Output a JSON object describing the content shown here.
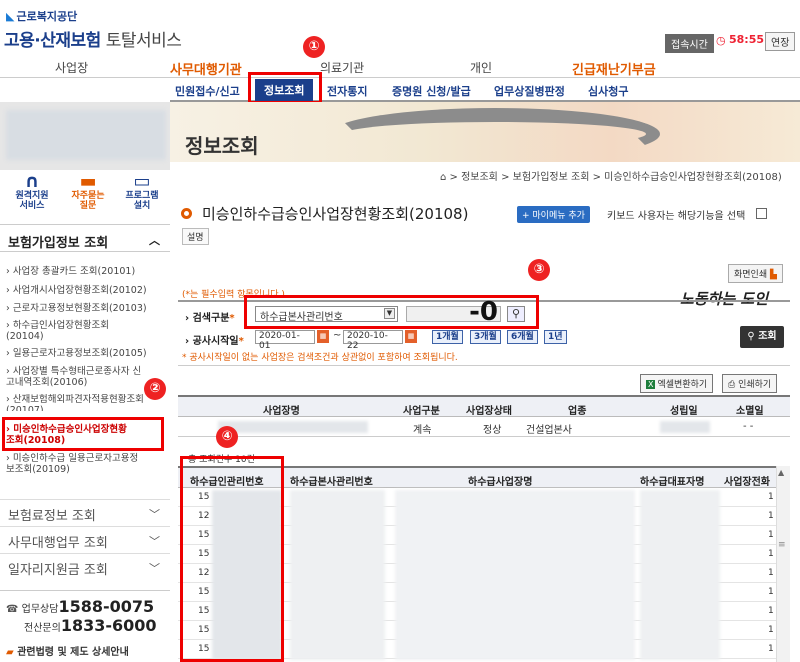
{
  "header": {
    "org_name": "근로복지공단",
    "service_title": "고용·산재보험",
    "service_sub": " 토탈서비스",
    "session_label": "접속시간",
    "session_time": "58:55",
    "extend_label": "연장"
  },
  "top_nav": [
    "사업장",
    "사무대행기관",
    "의료기관",
    "개인",
    "긴급재난기부금"
  ],
  "sub_nav": [
    "민원접수/신고",
    "정보조회",
    "전자통지",
    "증명원 신청/발급",
    "업무상질병판정",
    "심사청구"
  ],
  "badges": [
    "①",
    "②",
    "③",
    "④"
  ],
  "quick_links": [
    {
      "icon": "headset-icon",
      "glyph": "🎧",
      "label": "원격지원\n서비스"
    },
    {
      "icon": "chat-icon",
      "glyph": "💬",
      "label": "자주묻는\n질문"
    },
    {
      "icon": "monitor-icon",
      "glyph": "🖥",
      "label": "프로그램\n설치"
    }
  ],
  "sidebar": {
    "section_title": "보험가입정보 조회",
    "items": [
      "› 사업장 총괄카드 조회(20101)",
      "› 사업개시사업장현황조회(20102)",
      "› 근로자고용정보현황조회(20103)",
      "› 하수급인사업장현황조회\n  (20104)",
      "› 일용근로자고용정보조회(20105)",
      "› 사업장별 특수형태근로종사자 신\n  고내역조회(20106)",
      "› 산재보험해외파견자적용현황조회\n  (20107)",
      "› 미승인하수급승인사업장현황\n  조회(20108)",
      "› 미승인하수급 일용근로자고용정\n  보조회(20109)"
    ],
    "groups": [
      "보험료정보 조회",
      "사무대행업무 조회",
      "일자리지원금 조회"
    ],
    "phone_label1": "업무상담",
    "phone_number1": "1588-0075",
    "phone_label2": "전산문의",
    "phone_number2": "1833-6000",
    "law_link": "관련법령 및 제도 상세안내"
  },
  "banner_title": "정보조회",
  "breadcrumb": "⌂ > 정보조회 > 보험가입정보 조회 > 미승인하수급승인사업장현황조회(20108)",
  "page": {
    "title": "미승인하수급승인사업장현황조회(20108)",
    "mymenu_label": "+ 마이메뉴 추가",
    "keyboard_text": "키보드 사용자는 해당기능을 선택",
    "desc_label": "설명"
  },
  "search": {
    "print_screen_label": "화면인쇄",
    "required_note": "(*는 필수입력 항목입니다.)",
    "signature": "노동하는 도인",
    "type_label": "검색구분",
    "type_value": "하수급본사관리번호",
    "input_value": "-0",
    "period_label": "공사시작일",
    "date_from": "2020-01-01",
    "date_to": "2020-10-22",
    "period_buttons": [
      "1개월",
      "3개월",
      "6개월",
      "1년"
    ],
    "note": "* 공사시작일이 없는 사업장은 검색조건과 상관없이 포함하여 조회됩니다.",
    "search_button": "조회"
  },
  "actions": {
    "excel_label": "엑셀변환하기",
    "print_label": "인쇄하기"
  },
  "table1": {
    "headers": [
      "사업장명",
      "사업구분",
      "사업장상태",
      "업종",
      "성립일",
      "소멸일"
    ],
    "row": [
      "",
      "계속",
      "정상",
      "건설업본사",
      "",
      "- -"
    ]
  },
  "table2": {
    "total": "총 조회건수 10건",
    "headers": [
      "하수급인관리번호",
      "하수급본사관리번호",
      "하수급사업장명",
      "하수급대표자명",
      "사업장전화"
    ],
    "rows": [
      [
        "15",
        "1"
      ],
      [
        "12",
        "1"
      ],
      [
        "15",
        "1"
      ],
      [
        "15",
        "1"
      ],
      [
        "12",
        "1"
      ],
      [
        "15",
        "1"
      ],
      [
        "15",
        "1"
      ],
      [
        "15",
        "1"
      ],
      [
        "15",
        "1"
      ],
      [
        "15",
        "1"
      ]
    ]
  }
}
